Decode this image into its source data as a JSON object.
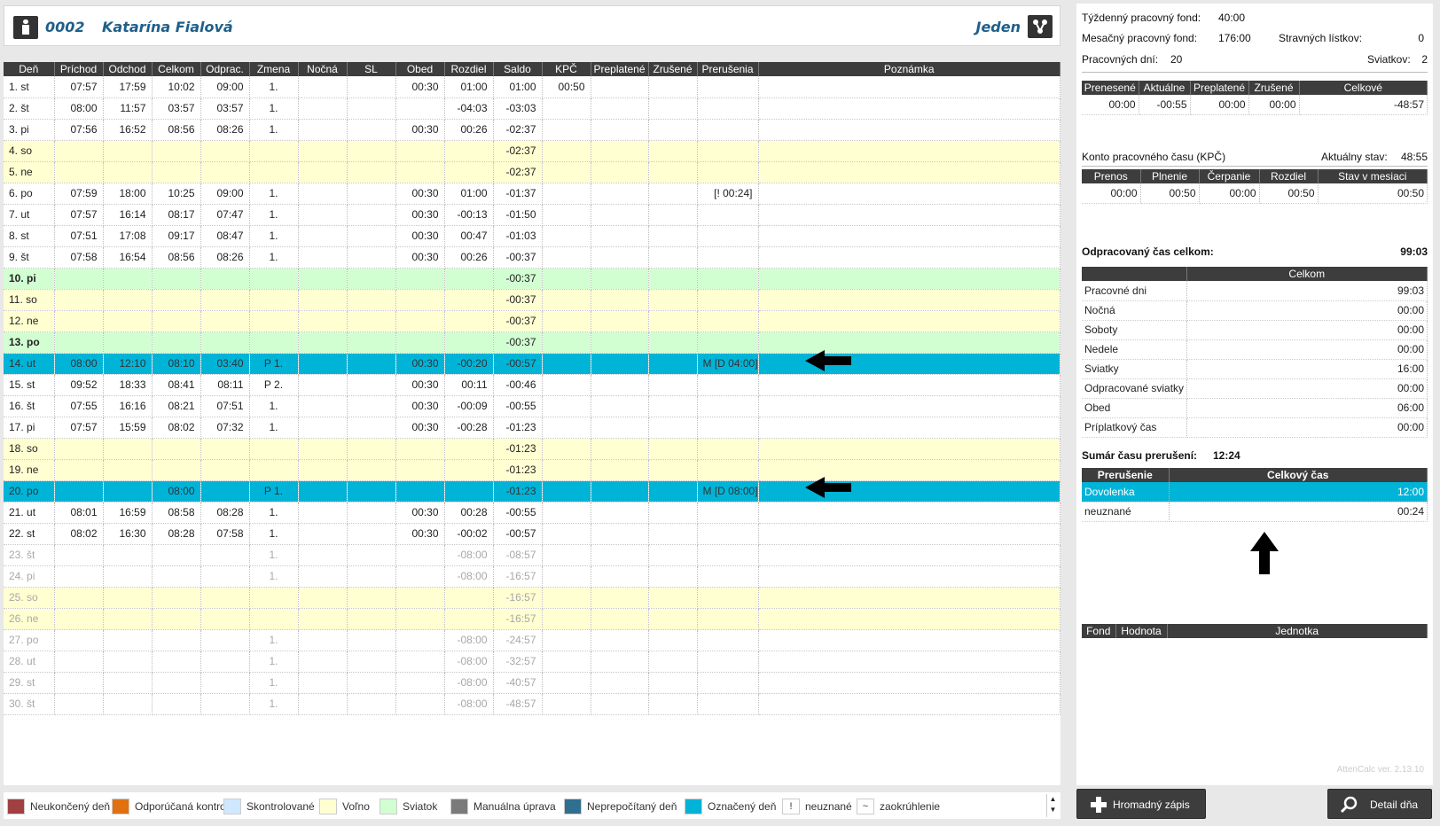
{
  "employee": {
    "id": "0002",
    "name": "Katarína Fialová",
    "group": "Jeden"
  },
  "grid": {
    "headers": [
      "Deň",
      "Príchod",
      "Odchod",
      "Celkom",
      "Odprac.",
      "Zmena",
      "Nočná",
      "SL",
      "Obed",
      "Rozdiel",
      "Saldo",
      "KPČ",
      "Preplatené",
      "Zrušené",
      "Prerušenia",
      "Poznámka"
    ],
    "rows": [
      {
        "type": "work",
        "cells": [
          "1. st",
          "07:57",
          "17:59",
          "10:02",
          "09:00",
          "1.",
          "",
          "",
          "00:30",
          "01:00",
          "01:00",
          "00:50",
          "",
          "",
          "",
          ""
        ]
      },
      {
        "type": "work",
        "cells": [
          "2. št",
          "08:00",
          "11:57",
          "03:57",
          "03:57",
          "1.",
          "",
          "",
          "",
          "-04:03",
          "-03:03",
          "",
          "",
          "",
          "",
          ""
        ]
      },
      {
        "type": "work",
        "cells": [
          "3. pi",
          "07:56",
          "16:52",
          "08:56",
          "08:26",
          "1.",
          "",
          "",
          "00:30",
          "00:26",
          "-02:37",
          "",
          "",
          "",
          "",
          ""
        ]
      },
      {
        "type": "weekend",
        "cells": [
          "4. so",
          "",
          "",
          "",
          "",
          "",
          "",
          "",
          "",
          "",
          "-02:37",
          "",
          "",
          "",
          "",
          ""
        ]
      },
      {
        "type": "weekend",
        "cells": [
          "5. ne",
          "",
          "",
          "",
          "",
          "",
          "",
          "",
          "",
          "",
          "-02:37",
          "",
          "",
          "",
          "",
          ""
        ]
      },
      {
        "type": "work",
        "cells": [
          "6. po",
          "07:59",
          "18:00",
          "10:25",
          "09:00",
          "1.",
          "",
          "",
          "00:30",
          "01:00",
          "-01:37",
          "",
          "",
          "",
          "[! 00:24]",
          ""
        ]
      },
      {
        "type": "work",
        "cells": [
          "7. ut",
          "07:57",
          "16:14",
          "08:17",
          "07:47",
          "1.",
          "",
          "",
          "00:30",
          "-00:13",
          "-01:50",
          "",
          "",
          "",
          "",
          ""
        ]
      },
      {
        "type": "work",
        "cells": [
          "8. st",
          "07:51",
          "17:08",
          "09:17",
          "08:47",
          "1.",
          "",
          "",
          "00:30",
          "00:47",
          "-01:03",
          "",
          "",
          "",
          "",
          ""
        ]
      },
      {
        "type": "work",
        "cells": [
          "9. št",
          "07:58",
          "16:54",
          "08:56",
          "08:26",
          "1.",
          "",
          "",
          "00:30",
          "00:26",
          "-00:37",
          "",
          "",
          "",
          "",
          ""
        ]
      },
      {
        "type": "holiday",
        "cells": [
          "10. pi",
          "",
          "",
          "",
          "",
          "",
          "",
          "",
          "",
          "",
          "-00:37",
          "",
          "",
          "",
          "",
          ""
        ]
      },
      {
        "type": "weekend",
        "cells": [
          "11. so",
          "",
          "",
          "",
          "",
          "",
          "",
          "",
          "",
          "",
          "-00:37",
          "",
          "",
          "",
          "",
          ""
        ]
      },
      {
        "type": "weekend",
        "cells": [
          "12. ne",
          "",
          "",
          "",
          "",
          "",
          "",
          "",
          "",
          "",
          "-00:37",
          "",
          "",
          "",
          "",
          ""
        ]
      },
      {
        "type": "holiday",
        "cells": [
          "13. po",
          "",
          "",
          "",
          "",
          "",
          "",
          "",
          "",
          "",
          "-00:37",
          "",
          "",
          "",
          "",
          ""
        ]
      },
      {
        "type": "selected",
        "cells": [
          "14. ut",
          "08:00",
          "12:10",
          "08:10",
          "03:40",
          "P 1.",
          "",
          "",
          "00:30",
          "-00:20",
          "-00:57",
          "",
          "",
          "",
          "M [D 04:00]",
          ""
        ]
      },
      {
        "type": "work",
        "cells": [
          "15. st",
          "09:52",
          "18:33",
          "08:41",
          "08:11",
          "P 2.",
          "",
          "",
          "00:30",
          "00:11",
          "-00:46",
          "",
          "",
          "",
          "",
          ""
        ]
      },
      {
        "type": "work",
        "cells": [
          "16. št",
          "07:55",
          "16:16",
          "08:21",
          "07:51",
          "1.",
          "",
          "",
          "00:30",
          "-00:09",
          "-00:55",
          "",
          "",
          "",
          "",
          ""
        ]
      },
      {
        "type": "work",
        "cells": [
          "17. pi",
          "07:57",
          "15:59",
          "08:02",
          "07:32",
          "1.",
          "",
          "",
          "00:30",
          "-00:28",
          "-01:23",
          "",
          "",
          "",
          "",
          ""
        ]
      },
      {
        "type": "weekend",
        "cells": [
          "18. so",
          "",
          "",
          "",
          "",
          "",
          "",
          "",
          "",
          "",
          "-01:23",
          "",
          "",
          "",
          "",
          ""
        ]
      },
      {
        "type": "weekend",
        "cells": [
          "19. ne",
          "",
          "",
          "",
          "",
          "",
          "",
          "",
          "",
          "",
          "-01:23",
          "",
          "",
          "",
          "",
          ""
        ]
      },
      {
        "type": "selected",
        "cells": [
          "20. po",
          "",
          "",
          "08:00",
          "",
          "P 1.",
          "",
          "",
          "",
          "",
          "-01:23",
          "",
          "",
          "",
          "M [D 08:00]",
          ""
        ]
      },
      {
        "type": "work",
        "cells": [
          "21. ut",
          "08:01",
          "16:59",
          "08:58",
          "08:28",
          "1.",
          "",
          "",
          "00:30",
          "00:28",
          "-00:55",
          "",
          "",
          "",
          "",
          ""
        ]
      },
      {
        "type": "work",
        "cells": [
          "22. st",
          "08:02",
          "16:30",
          "08:28",
          "07:58",
          "1.",
          "",
          "",
          "00:30",
          "-00:02",
          "-00:57",
          "",
          "",
          "",
          "",
          ""
        ]
      },
      {
        "type": "future",
        "cells": [
          "23. št",
          "",
          "",
          "",
          "",
          "1.",
          "",
          "",
          "",
          "-08:00",
          "-08:57",
          "",
          "",
          "",
          "",
          ""
        ]
      },
      {
        "type": "future",
        "cells": [
          "24. pi",
          "",
          "",
          "",
          "",
          "1.",
          "",
          "",
          "",
          "-08:00",
          "-16:57",
          "",
          "",
          "",
          "",
          ""
        ]
      },
      {
        "type": "future-weekend",
        "cells": [
          "25. so",
          "",
          "",
          "",
          "",
          "",
          "",
          "",
          "",
          "",
          "-16:57",
          "",
          "",
          "",
          "",
          ""
        ]
      },
      {
        "type": "future-weekend",
        "cells": [
          "26. ne",
          "",
          "",
          "",
          "",
          "",
          "",
          "",
          "",
          "",
          "-16:57",
          "",
          "",
          "",
          "",
          ""
        ]
      },
      {
        "type": "future",
        "cells": [
          "27. po",
          "",
          "",
          "",
          "",
          "1.",
          "",
          "",
          "",
          "-08:00",
          "-24:57",
          "",
          "",
          "",
          "",
          ""
        ]
      },
      {
        "type": "future",
        "cells": [
          "28. ut",
          "",
          "",
          "",
          "",
          "1.",
          "",
          "",
          "",
          "-08:00",
          "-32:57",
          "",
          "",
          "",
          "",
          ""
        ]
      },
      {
        "type": "future",
        "cells": [
          "29. st",
          "",
          "",
          "",
          "",
          "1.",
          "",
          "",
          "",
          "-08:00",
          "-40:57",
          "",
          "",
          "",
          "",
          ""
        ]
      },
      {
        "type": "future",
        "cells": [
          "30. št",
          "",
          "",
          "",
          "",
          "1.",
          "",
          "",
          "",
          "-08:00",
          "-48:57",
          "",
          "",
          "",
          "",
          ""
        ]
      }
    ]
  },
  "legend": [
    {
      "label": "Neukončený deň",
      "color": "#a04040"
    },
    {
      "label": "Odporúčaná kontrola",
      "color": "#e07010"
    },
    {
      "label": "Skontrolované",
      "color": "#cfe8ff"
    },
    {
      "label": "Voľno",
      "color": "#ffffd2"
    },
    {
      "label": "Sviatok",
      "color": "#d2ffd2"
    },
    {
      "label": "Manuálna úprava",
      "color": "#7a7a7a"
    },
    {
      "label": "Neprepočítaný deň",
      "color": "#2f6f8f"
    },
    {
      "label": "Označený deň",
      "color": "#00b4d8"
    },
    {
      "label": "neuznané",
      "symbol": "!"
    },
    {
      "label": "zaokrúhlenie",
      "symbol": "~"
    }
  ],
  "summary": {
    "weekly_fund_label": "Týždenný pracovný fond:",
    "weekly_fund": "40:00",
    "monthly_fund_label": "Mesačný pracovný fond:",
    "monthly_fund": "176:00",
    "meal_label": "Stravných lístkov:",
    "meal": "0",
    "workdays_label": "Pracovných dní:",
    "workdays": "20",
    "holidays_label": "Sviatkov:",
    "holidays": "2",
    "balance": {
      "headers": [
        "Prenesené",
        "Aktuálne",
        "Preplatené",
        "Zrušené",
        "Celkové"
      ],
      "values": [
        "00:00",
        "-00:55",
        "00:00",
        "00:00",
        "-48:57"
      ]
    },
    "kpc_title": "Konto pracovného času (KPČ)",
    "kpc_state_label": "Aktuálny stav:",
    "kpc_state": "48:55",
    "kpc": {
      "headers": [
        "Prenos",
        "Plnenie",
        "Čerpanie",
        "Rozdiel",
        "Stav v mesiaci"
      ],
      "values": [
        "00:00",
        "00:50",
        "00:00",
        "00:50",
        "00:50"
      ]
    },
    "worked_label": "Odpracovaný čas celkom:",
    "worked": "99:03",
    "worked_table": {
      "header": "Celkom",
      "rows": [
        [
          "Pracovné dni",
          "99:03"
        ],
        [
          "Nočná",
          "00:00"
        ],
        [
          "Soboty",
          "00:00"
        ],
        [
          "Nedele",
          "00:00"
        ],
        [
          "Sviatky",
          "16:00"
        ],
        [
          "Odpracované sviatky",
          "00:00"
        ],
        [
          "Obed",
          "06:00"
        ],
        [
          "Príplatkový čas",
          "00:00"
        ]
      ]
    },
    "interrupt_label": "Sumár času prerušení:",
    "interrupt": "12:24",
    "interrupt_table": {
      "headers": [
        "Prerušenie",
        "Celkový čas"
      ],
      "rows": [
        [
          "Dovolenka",
          "12:00"
        ],
        [
          "neuznané",
          "00:24"
        ]
      ]
    },
    "fond_table": {
      "headers": [
        "Fond",
        "Hodnota",
        "Jednotka"
      ]
    },
    "version": "AttenCalc ver. 2.13.10"
  },
  "buttons": {
    "bulk": "Hromadný zápis",
    "detail": "Detail dňa"
  }
}
